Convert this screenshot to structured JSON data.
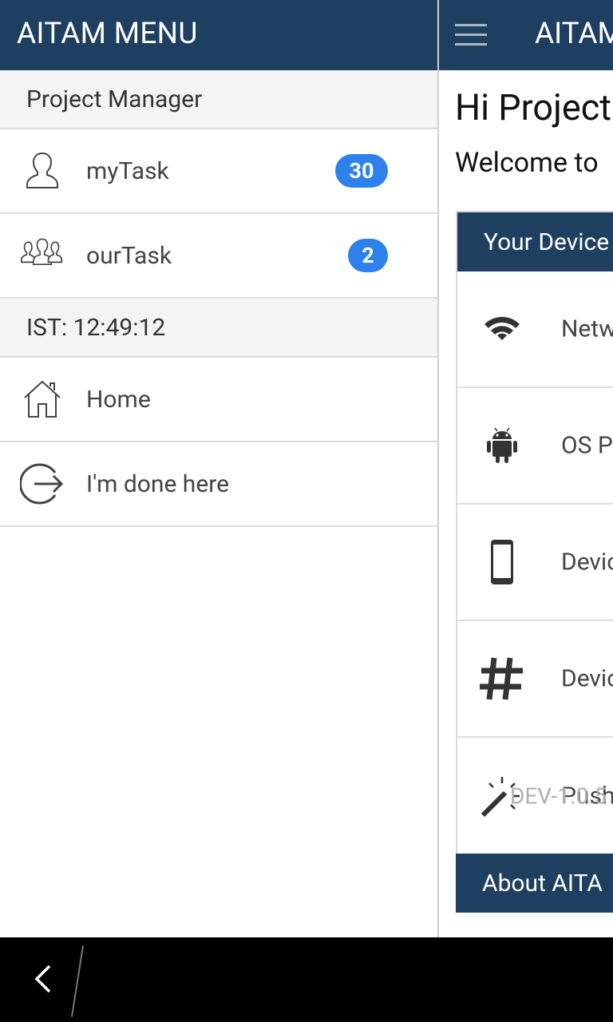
{
  "drawer": {
    "title": "AITAM MENU",
    "role_label": "Project Manager",
    "items": [
      {
        "label": "myTask",
        "badge": "30",
        "icon": "person-icon"
      },
      {
        "label": "ourTask",
        "badge": "2",
        "icon": "group-icon"
      }
    ],
    "clock": "IST: 12:49:12",
    "nav": [
      {
        "label": "Home",
        "icon": "home-icon"
      },
      {
        "label": "I'm done here",
        "icon": "logout-icon"
      }
    ]
  },
  "main": {
    "app_title": "AITAM",
    "greeting": "Hi Project",
    "welcome": "Welcome to",
    "device_card": {
      "header": "Your Device",
      "rows": [
        {
          "label": "Netw",
          "icon": "wifi-icon"
        },
        {
          "label": "OS P",
          "icon": "android-icon"
        },
        {
          "label": "Devic",
          "icon": "phone-icon"
        },
        {
          "label": "Devic",
          "icon": "hash-icon"
        },
        {
          "label": "Push",
          "icon": "magic-wand-icon",
          "overlay": "DEV-1.0.5"
        }
      ]
    },
    "about_header": "About AITA"
  },
  "colors": {
    "header_bg": "#1f3f61",
    "badge_bg": "#2e80eb",
    "section_bg": "#f4f4f4"
  }
}
